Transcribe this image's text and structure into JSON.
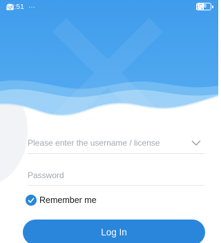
{
  "status_bar": {
    "time": "10:51",
    "left_icons": [
      "whatsapp-icon",
      "whatsapp-icon",
      "app-icon",
      "more-dots-icon"
    ],
    "more": "···",
    "right_icons": [
      "bluetooth-icon",
      "signal-icon",
      "signal-icon",
      "wifi-icon",
      "battery-icon"
    ],
    "battery_level": "90"
  },
  "colors": {
    "header_blue": "#4aa3ef",
    "accent_blue": "#2a86db",
    "placeholder_gray": "#a3a8ae"
  },
  "login_form": {
    "username_placeholder": "Please enter the username / license",
    "password_placeholder": "Password",
    "remember_label": "Remember me",
    "remember_checked": true,
    "login_label": "Log In"
  }
}
